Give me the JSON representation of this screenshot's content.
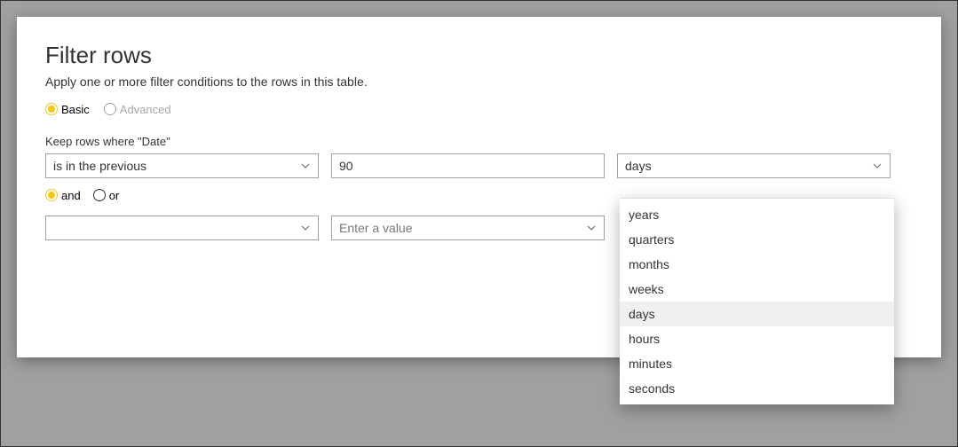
{
  "dialog": {
    "title": "Filter rows",
    "subtitle": "Apply one or more filter conditions to the rows in this table."
  },
  "mode": {
    "basic": "Basic",
    "advanced": "Advanced"
  },
  "keep_label": "Keep rows where \"Date\"",
  "row1": {
    "operator": "is in the previous",
    "value": "90",
    "unit_selected": "days"
  },
  "logic": {
    "and": "and",
    "or": "or"
  },
  "row2": {
    "operator": "",
    "value_placeholder": "Enter a value"
  },
  "unit_options": [
    "years",
    "quarters",
    "months",
    "weeks",
    "days",
    "hours",
    "minutes",
    "seconds"
  ],
  "unit_highlight": "days",
  "colors": {
    "accent": "#f2c811",
    "border": "#a0a0a0",
    "text": "#333333",
    "muted": "#a6a6a6"
  }
}
